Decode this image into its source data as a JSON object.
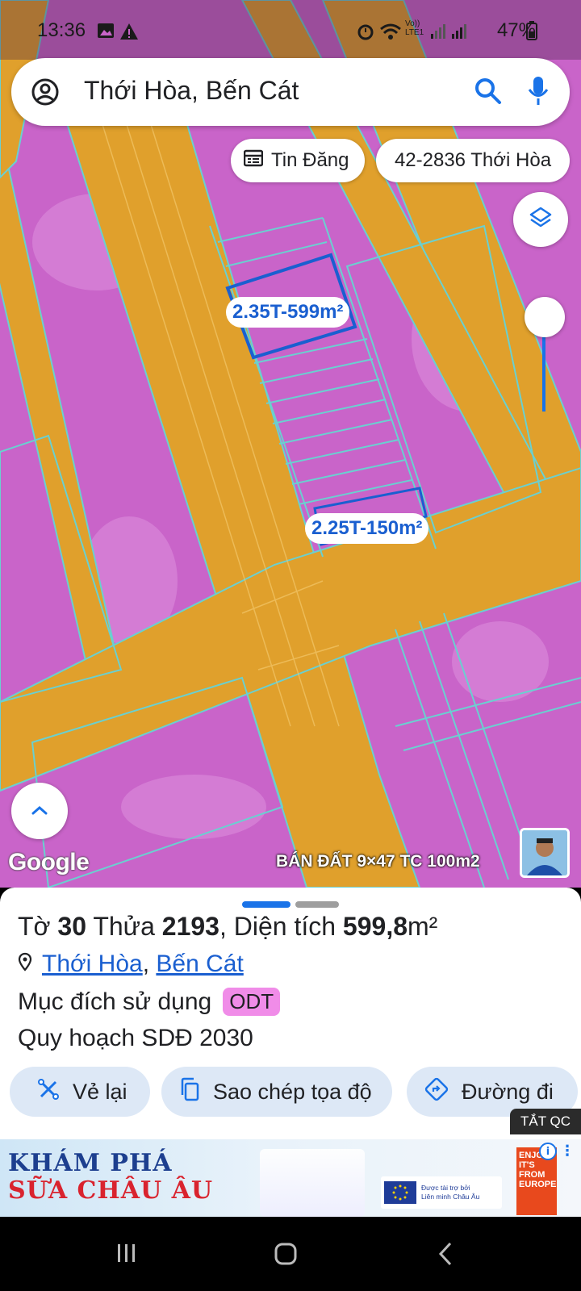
{
  "status_bar": {
    "time": "13:36",
    "network_label_top": "Vo))",
    "network_label_bottom": "LTE1",
    "battery_percent": "47%"
  },
  "search": {
    "query": "Thới Hòa, Bến Cát",
    "icons": [
      "account-icon",
      "search-icon",
      "mic-icon"
    ]
  },
  "chips": {
    "listings_label": "Tin Đăng",
    "parcel_label": "42-2836 Thới Hòa"
  },
  "map": {
    "plot_labels": [
      "2.35T-599m²",
      "2.25T-150m²"
    ],
    "watermark": "Google",
    "overlay_text": "BÁN  ĐẤT  9×47 TC 100m2",
    "colors": {
      "land_residential": "#c964c9",
      "roads": "#e0a02c",
      "parcel_lines": "#6ad0d0",
      "selected_parcel": "#1a5fd0"
    }
  },
  "sheet": {
    "to_label": "Tờ",
    "to_value": "30",
    "thua_label": "Thửa",
    "thua_value": "2193",
    "area_label": "Diện tích",
    "area_value": "599,8",
    "area_unit": "m²",
    "location_ward": "Thới Hòa",
    "location_district": "Bến Cát",
    "purpose_label": "Mục đích sử dụng",
    "purpose_code": "ODT",
    "planning": "Quy hoạch SDĐ 2030",
    "buttons": {
      "redraw": "Vẻ lại",
      "copy_coords": "Sao chép tọa độ",
      "directions": "Đường đi"
    }
  },
  "ad": {
    "close_label": "TẮT QC",
    "headline_1": "KHÁM PHÁ",
    "headline_2": "SỮA CHÂU ÂU",
    "sponsor_line_1": "Được tài trợ bởi",
    "sponsor_line_2": "Liên minh Châu Âu",
    "side_text": "ENJOY IT'S FROM EUROPE"
  }
}
